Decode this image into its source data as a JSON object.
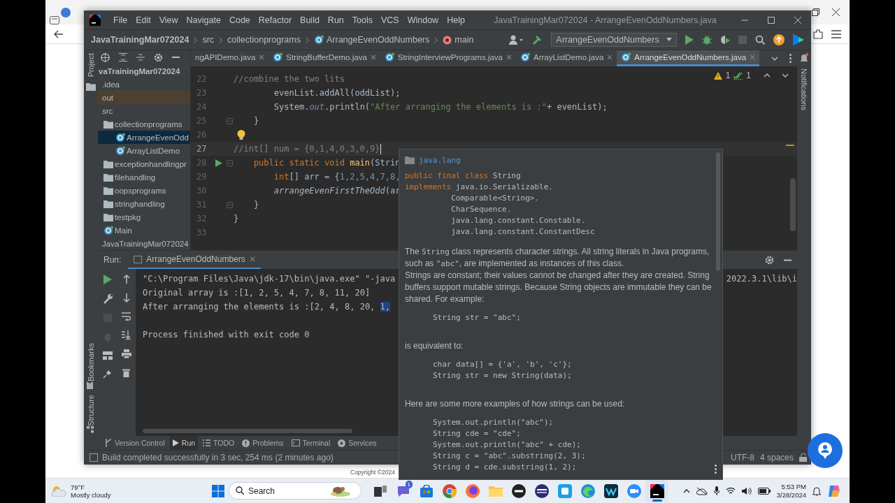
{
  "ide": {
    "menu": [
      "File",
      "Edit",
      "View",
      "Navigate",
      "Code",
      "Refactor",
      "Build",
      "Run",
      "Tools",
      "VCS",
      "Window",
      "Help"
    ],
    "title": "JavaTrainingMar072024 - ArrangeEvenOddNumbers.java",
    "breadcrumbs": [
      {
        "text": "JavaTrainingMar072024",
        "kind": "project"
      },
      {
        "text": "src",
        "kind": "folder"
      },
      {
        "text": "collectionprograms",
        "kind": "folder"
      },
      {
        "text": "ArrangeEvenOddNumbers",
        "kind": "class"
      },
      {
        "text": "main",
        "kind": "method"
      }
    ],
    "run_config": "ArrangeEvenOddNumbers",
    "left_labels": [
      "Project",
      "Bookmarks",
      "Structure"
    ],
    "right_label": "Notifications",
    "tree": [
      {
        "label": "vaTrainingMar072024",
        "kind": "module",
        "selected": false,
        "children": [
          {
            "label": ".idea",
            "kind": "plain",
            "selected": false
          },
          {
            "label": "out",
            "kind": "excluded",
            "selected": false
          },
          {
            "label": "src",
            "kind": "plain",
            "selected": false,
            "children": [
              {
                "label": "collectionprograms",
                "kind": "package",
                "selected": false,
                "children": [
                  {
                    "label": "ArrangeEvenOdd",
                    "kind": "class",
                    "selected": true
                  },
                  {
                    "label": "ArrayListDemo",
                    "kind": "class",
                    "selected": false
                  }
                ]
              },
              {
                "label": "exceptionhandlingpr",
                "kind": "package",
                "selected": false
              },
              {
                "label": "filehandling",
                "kind": "package",
                "selected": false
              },
              {
                "label": "oopsprograms",
                "kind": "package",
                "selected": false
              },
              {
                "label": "stringhandling",
                "kind": "package",
                "selected": false
              },
              {
                "label": "testpkg",
                "kind": "package",
                "selected": false
              },
              {
                "label": "Main",
                "kind": "class",
                "selected": false
              }
            ]
          },
          {
            "label": "JavaTrainingMar072024",
            "kind": "plain",
            "selected": false
          }
        ]
      }
    ],
    "editor_tabs": [
      {
        "label": "ngAPIDemo.java",
        "kind": "partial",
        "selected": false
      },
      {
        "label": "StringBufferDemo.java",
        "kind": "class",
        "selected": false
      },
      {
        "label": "StringInterviewPrograms.java",
        "kind": "class",
        "selected": false
      },
      {
        "label": "ArrayListDemo.java",
        "kind": "class",
        "selected": false
      },
      {
        "label": "ArrangeEvenOddNumbers.java",
        "kind": "class",
        "selected": true
      }
    ],
    "inspections": {
      "warnings": "1",
      "weak_warnings": "1"
    },
    "code_lines": [
      {
        "number": "22",
        "current": false,
        "kind": "plain",
        "tokens": [
          {
            "text": "//combine the two lits",
            "kind": "comment"
          }
        ]
      },
      {
        "number": "23",
        "current": false,
        "kind": "plain",
        "tokens": [
          {
            "text": "        evenList.addAll(oddList);",
            "kind": "plain"
          }
        ]
      },
      {
        "number": "24",
        "current": false,
        "kind": "plain",
        "tokens": [
          {
            "text": "        System.",
            "kind": "plain"
          },
          {
            "text": "out",
            "kind": "static"
          },
          {
            "text": ".println(",
            "kind": "plain"
          },
          {
            "text": "\"After arranging the elements is :\"",
            "kind": "string"
          },
          {
            "text": "+ evenList);",
            "kind": "plain"
          }
        ]
      },
      {
        "number": "25",
        "current": false,
        "kind": "fold",
        "tokens": [
          {
            "text": "    }",
            "kind": "plain"
          }
        ]
      },
      {
        "number": "26",
        "current": false,
        "kind": "bulb"
      },
      {
        "number": "27",
        "current": true,
        "kind": "plain",
        "tokens": [
          {
            "text": "//int[] num = {0,1,4,0,3,0,9}",
            "kind": "comment"
          }
        ]
      },
      {
        "number": "28",
        "current": false,
        "kind": "run",
        "tokens": [
          {
            "text": "    public static void ",
            "kind": "keyword"
          },
          {
            "text": "main",
            "kind": "method"
          },
          {
            "text": "(Strin",
            "kind": "plain"
          }
        ]
      },
      {
        "number": "29",
        "current": false,
        "kind": "plain",
        "tokens": [
          {
            "text": "        int",
            "kind": "keyword"
          },
          {
            "text": "[] arr = {",
            "kind": "plain"
          },
          {
            "text": "1,2,5,4,7,8,",
            "kind": "number"
          }
        ]
      },
      {
        "number": "30",
        "current": false,
        "kind": "plain",
        "tokens": [
          {
            "text": "        arrangeEvenFirstTheOdd",
            "kind": "italic"
          },
          {
            "text": "(ar",
            "kind": "plain"
          }
        ]
      },
      {
        "number": "31",
        "current": false,
        "kind": "fold",
        "tokens": [
          {
            "text": "    }",
            "kind": "plain"
          }
        ]
      },
      {
        "number": "32",
        "current": false,
        "kind": "plain",
        "tokens": [
          {
            "text": "}",
            "kind": "plain"
          }
        ]
      },
      {
        "number": "33",
        "current": false,
        "kind": "plain"
      }
    ],
    "run": {
      "label": "Run:",
      "tab": "ArrangeEvenOddNumbers",
      "console": [
        {
          "kind": "output",
          "text": "\"C:\\Program Files\\Java\\jdk-17\\bin\\java.exe\" \"-java",
          "tail": "2022.3.1\\lib\\i"
        },
        {
          "kind": "output",
          "text": "Original array is :[1, 2, 5, 4, 7, 8, 11, 20]"
        },
        {
          "kind": "output",
          "text": "After arranging the elements is :[2, 4, 8, 20, ",
          "selection": "1,"
        },
        {
          "kind": "exit",
          "text": "Process finished with exit code 0"
        }
      ]
    },
    "tool_buttons": [
      {
        "label": "Version Control",
        "kind": "vcs",
        "selected": false
      },
      {
        "label": "Run",
        "kind": "run",
        "selected": true
      },
      {
        "label": "TODO",
        "kind": "todo",
        "selected": false
      },
      {
        "label": "Problems",
        "kind": "problems",
        "selected": false
      },
      {
        "label": "Terminal",
        "kind": "terminal",
        "selected": false
      },
      {
        "label": "Services",
        "kind": "services",
        "selected": false
      }
    ],
    "status": {
      "message": "Build completed successfully in 3 sec, 254 ms (2 minutes ago)",
      "encoding": "UTF-8",
      "indent": "4 spaces"
    }
  },
  "doc_popup": {
    "package": "java.lang",
    "signature": [
      [
        {
          "text": "public final class ",
          "kind": "keyword"
        },
        {
          "text": "String",
          "kind": "plain"
        }
      ],
      [
        {
          "text": "implements ",
          "kind": "keyword"
        },
        {
          "text": "java.io.Serializable",
          "kind": "plain"
        },
        {
          "text": ",",
          "kind": "keyword"
        }
      ],
      [
        {
          "text": "          Comparable<String>",
          "kind": "plain"
        },
        {
          "text": ",",
          "kind": "keyword"
        }
      ],
      [
        {
          "text": "          CharSequence",
          "kind": "plain"
        },
        {
          "text": ",",
          "kind": "keyword"
        }
      ],
      [
        {
          "text": "          java.lang.constant.Constable",
          "kind": "plain"
        },
        {
          "text": ",",
          "kind": "keyword"
        }
      ],
      [
        {
          "text": "          java.lang.constant.ConstantDesc",
          "kind": "plain"
        }
      ]
    ],
    "blocks": [
      {
        "kind": "text",
        "parts": [
          {
            "text": "The ",
            "code": false
          },
          {
            "text": "String",
            "code": true
          },
          {
            "text": " class represents character strings. All string literals in Java programs, such as ",
            "code": false
          },
          {
            "text": "\"abc\"",
            "code": true
          },
          {
            "text": ", are implemented as instances of this class.",
            "code": false
          }
        ]
      },
      {
        "kind": "text",
        "parts": [
          {
            "text": "Strings are constant; their values cannot be changed after they are created. String buffers support mutable strings. Because String objects are immutable they can be shared. For example:",
            "code": false
          }
        ]
      },
      {
        "kind": "code",
        "lines": [
          "String str = \"abc\";"
        ]
      },
      {
        "kind": "text",
        "parts": [
          {
            "text": "is equivalent to:",
            "code": false
          }
        ]
      },
      {
        "kind": "code",
        "lines": [
          "char data[] = {'a', 'b', 'c'};",
          "String str = new String(data);"
        ]
      },
      {
        "kind": "text",
        "parts": [
          {
            "text": "Here are some more examples of how strings can be used:",
            "code": false
          }
        ]
      },
      {
        "kind": "code",
        "lines": [
          "System.out.println(\"abc\");",
          "String cde = \"cde\";",
          "System.out.println(\"abc\" + cde);",
          "String c = \"abc\".substring(2, 3);",
          "String d = cde.substring(1, 2);"
        ]
      }
    ]
  },
  "page_footer": "Copyright ©2024",
  "taskbar": {
    "weather": {
      "temp": "79°F",
      "text": "Mostly cloudy"
    },
    "search_placeholder": "Search",
    "apps": [
      {
        "kind": "taskview",
        "selected": false
      },
      {
        "kind": "chat",
        "badge": "1",
        "selected": false
      },
      {
        "kind": "store",
        "selected": false
      },
      {
        "kind": "browser",
        "selected": false
      },
      {
        "kind": "fox",
        "selected": false
      },
      {
        "kind": "folder",
        "selected": false
      },
      {
        "kind": "round",
        "selected": false
      },
      {
        "kind": "stripes",
        "selected": false
      },
      {
        "kind": "square",
        "selected": false
      },
      {
        "kind": "wave",
        "selected": false
      },
      {
        "kind": "webex",
        "selected": false
      },
      {
        "kind": "camera",
        "selected": false
      },
      {
        "kind": "ide",
        "selected": true
      }
    ],
    "time": "5:53 PM",
    "date": "3/28/2024"
  }
}
